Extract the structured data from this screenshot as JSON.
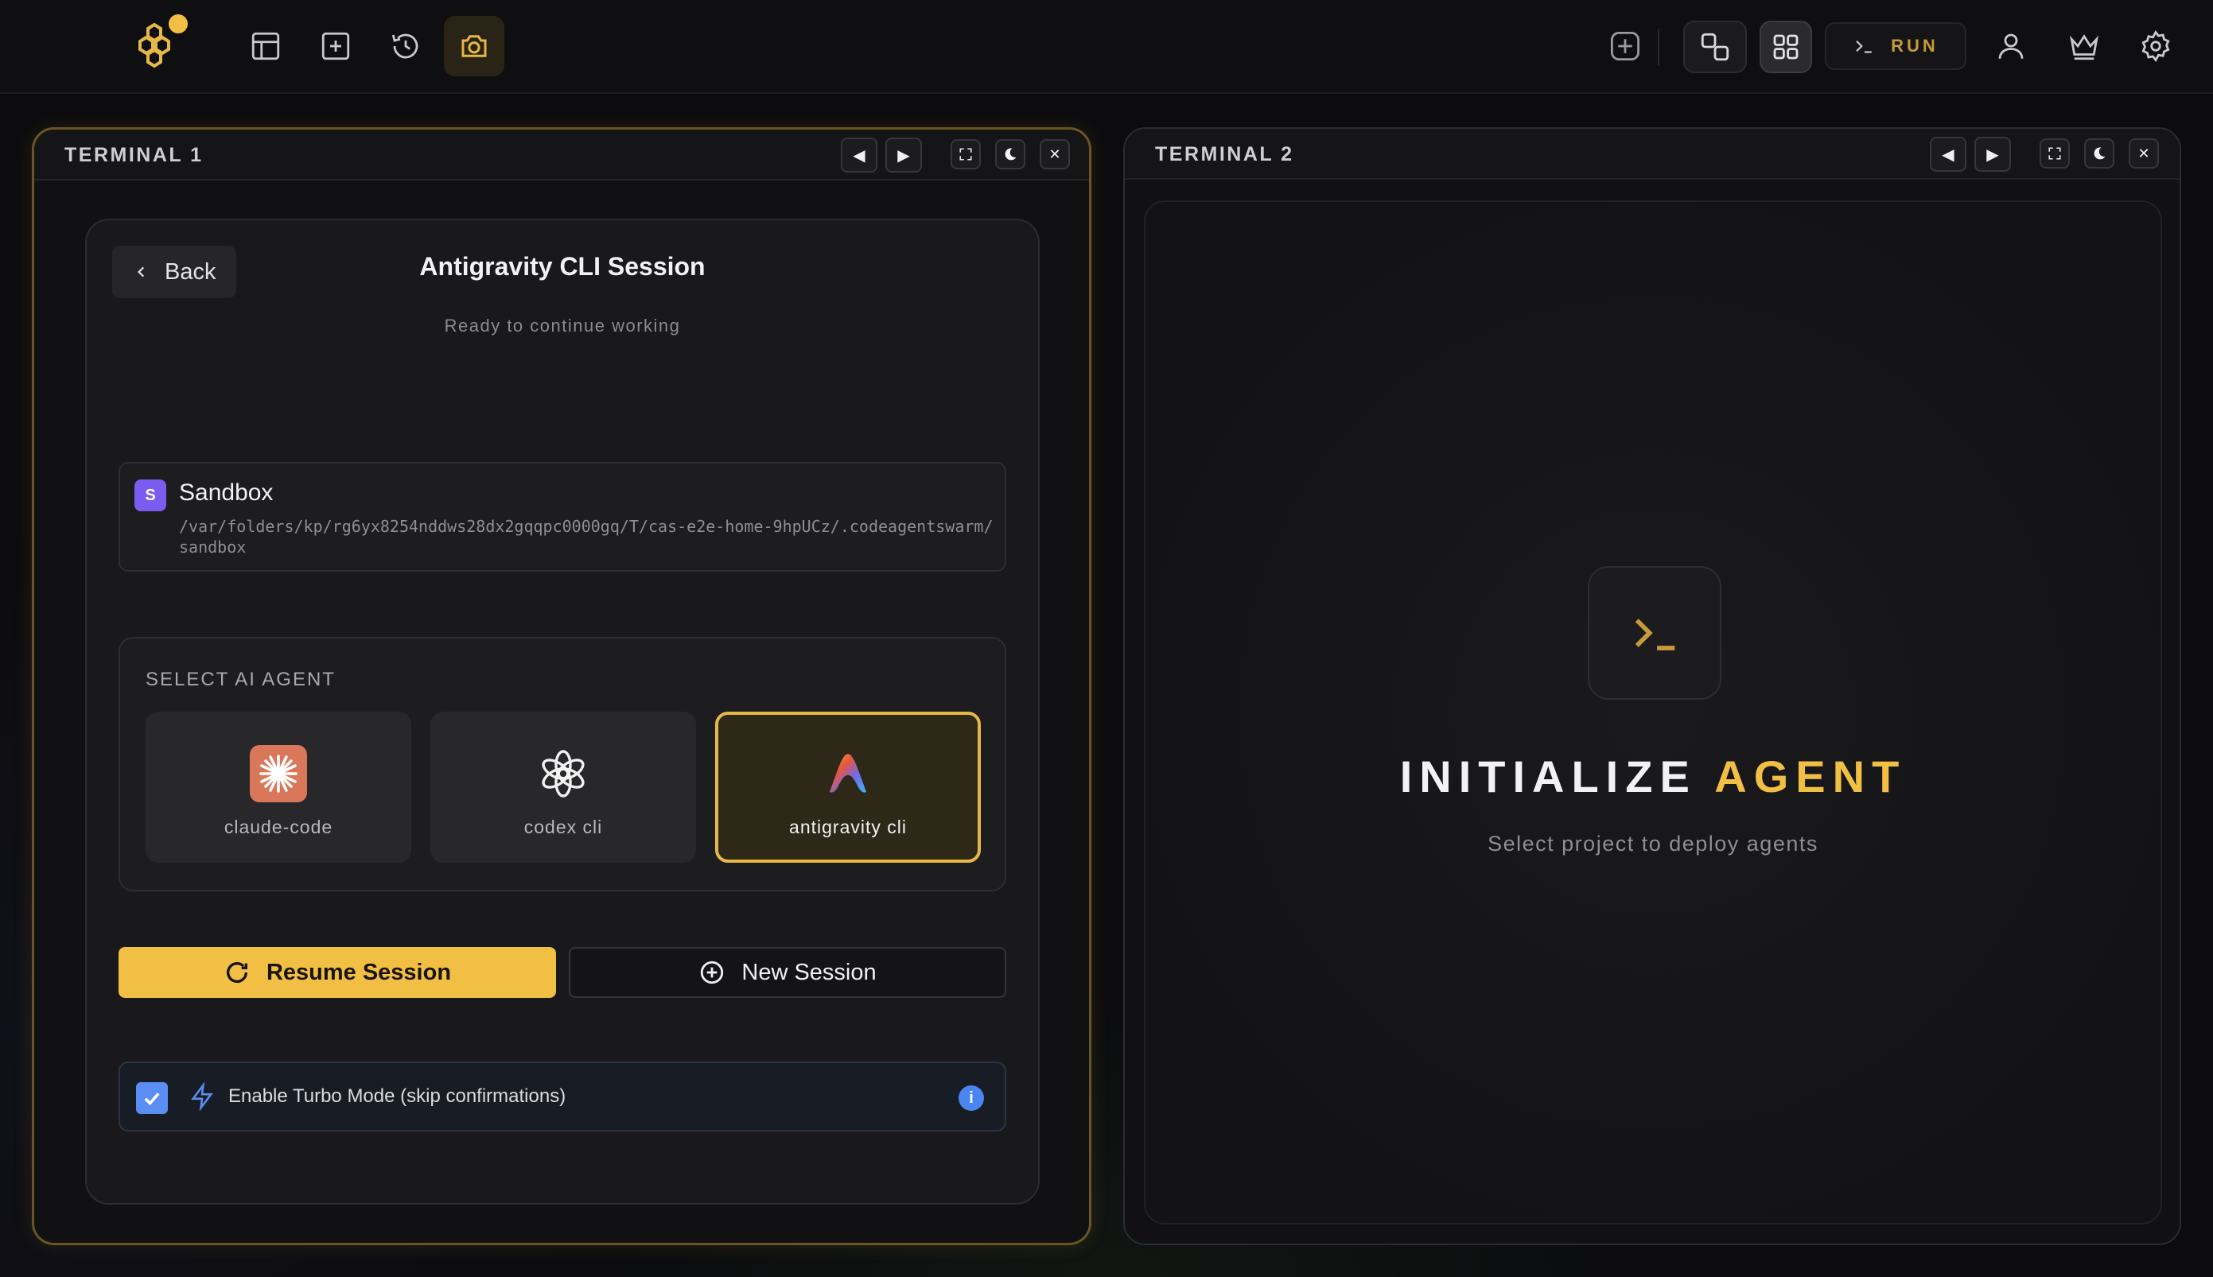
{
  "topbar": {
    "run_label": "RUN"
  },
  "terminal1": {
    "title": "TERMINAL 1",
    "back_label": "Back",
    "session_title": "Antigravity CLI Session",
    "session_subtitle": "Ready to continue working",
    "project": {
      "initial": "S",
      "name": "Sandbox",
      "path": "/var/folders/kp/rg6yx8254nddws28dx2gqqpc0000gq/T/cas-e2e-home-9hpUCz/.codeagentswarm/sandbox"
    },
    "agent_section_label": "SELECT AI AGENT",
    "agents": [
      {
        "name": "claude-code",
        "selected": false
      },
      {
        "name": "codex cli",
        "selected": false
      },
      {
        "name": "antigravity cli",
        "selected": true
      }
    ],
    "resume_label": "Resume Session",
    "new_label": "New Session",
    "turbo_label": "Enable Turbo Mode (skip confirmations)",
    "turbo_checked": true,
    "info_glyph": "i"
  },
  "terminal2": {
    "title": "TERMINAL 2",
    "init_word1": "INITIALIZE",
    "init_word2": "AGENT",
    "init_subtitle": "Select project to deploy agents"
  },
  "colors": {
    "accent": "#f1bf44",
    "panel_active_border": "#6a5524",
    "check_blue": "#5b8ef2",
    "avatar_purple": "#7b5cf0"
  }
}
